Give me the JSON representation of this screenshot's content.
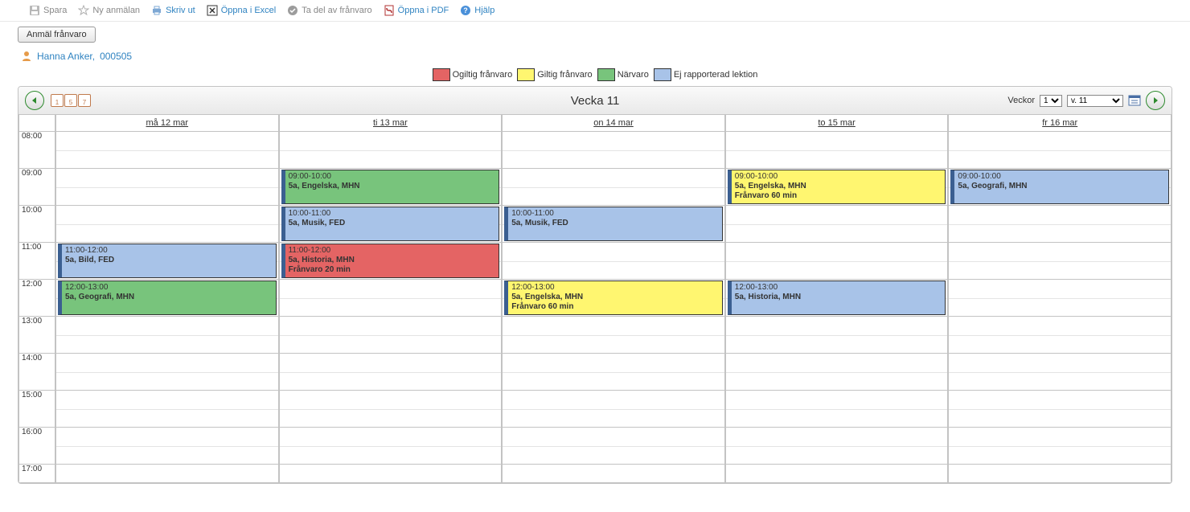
{
  "toolbar": {
    "spara": "Spara",
    "ny": "Ny anmälan",
    "skriv": "Skriv ut",
    "excel": "Öppna i Excel",
    "tadel": "Ta del av frånvaro",
    "pdf": "Öppna i PDF",
    "hjalp": "Hjälp"
  },
  "buttons": {
    "anmal": "Anmäl frånvaro"
  },
  "user": {
    "name": "Hanna Anker,",
    "id": "000505"
  },
  "legend": {
    "ogiltig": "Ogiltig frånvaro",
    "giltig": "Giltig frånvaro",
    "narvaro": "Närvaro",
    "ej": "Ej rapporterad lektion"
  },
  "nav": {
    "title": "Vecka 11",
    "veckor_label": "Veckor",
    "veckor_value": "1",
    "week_value": "v. 11",
    "days": [
      "må 12 mar",
      "ti 13 mar",
      "on 14 mar",
      "to 15 mar",
      "fr 16 mar"
    ],
    "times": [
      "08:00",
      "09:00",
      "10:00",
      "11:00",
      "12:00",
      "13:00",
      "14:00",
      "15:00",
      "16:00",
      "17:00"
    ]
  },
  "events": {
    "mon": [
      {
        "row": 3,
        "color": "blue",
        "time": "11:00-12:00",
        "line1": "5a, Bild, FED",
        "line2": ""
      },
      {
        "row": 4,
        "color": "green",
        "time": "12:00-13:00",
        "line1": "5a, Geografi, MHN",
        "line2": ""
      }
    ],
    "tue": [
      {
        "row": 1,
        "color": "green",
        "time": "09:00-10:00",
        "line1": "5a, Engelska, MHN",
        "line2": ""
      },
      {
        "row": 2,
        "color": "blue",
        "time": "10:00-11:00",
        "line1": "5a, Musik, FED",
        "line2": ""
      },
      {
        "row": 3,
        "color": "red",
        "time": "11:00-12:00",
        "line1": "5a, Historia, MHN",
        "line2": "Frånvaro 20 min"
      }
    ],
    "wed": [
      {
        "row": 2,
        "color": "blue",
        "time": "10:00-11:00",
        "line1": "5a, Musik, FED",
        "line2": ""
      },
      {
        "row": 4,
        "color": "yellow",
        "time": "12:00-13:00",
        "line1": "5a, Engelska, MHN",
        "line2": "Frånvaro 60 min"
      }
    ],
    "thu": [
      {
        "row": 1,
        "color": "yellow",
        "time": "09:00-10:00",
        "line1": "5a, Engelska, MHN",
        "line2": "Frånvaro 60 min"
      },
      {
        "row": 4,
        "color": "blue",
        "time": "12:00-13:00",
        "line1": "5a, Historia, MHN",
        "line2": ""
      }
    ],
    "fri": [
      {
        "row": 1,
        "color": "blue",
        "time": "09:00-10:00",
        "line1": "5a, Geografi, MHN",
        "line2": ""
      }
    ]
  }
}
